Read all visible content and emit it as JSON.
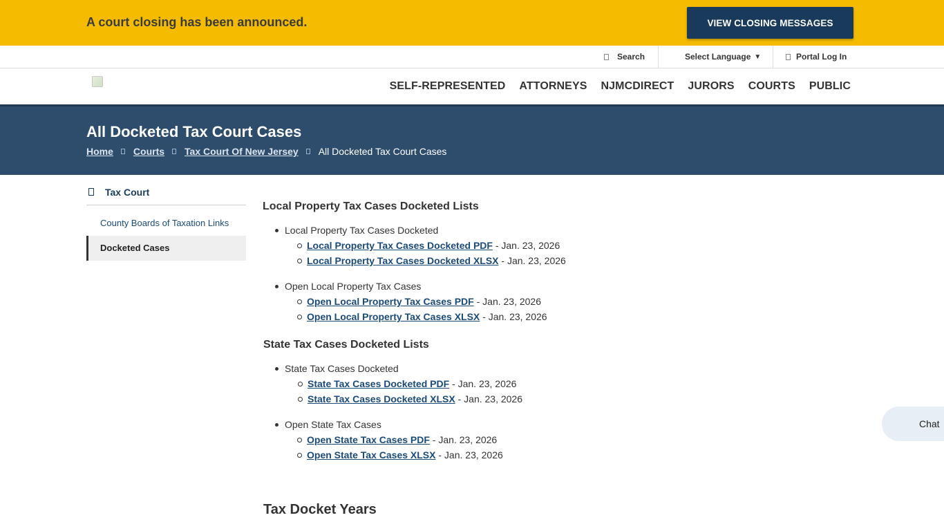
{
  "alert": {
    "message": "A court closing has been announced.",
    "button_label": "VIEW CLOSING MESSAGES"
  },
  "utility": {
    "search_label": "Search",
    "language_label": "Select Language",
    "language_caret": "▼",
    "portal_label": "Portal Log In"
  },
  "nav": {
    "items": [
      "SELF-REPRESENTED",
      "ATTORNEYS",
      "NJMCDIRECT",
      "JURORS",
      "COURTS",
      "PUBLIC"
    ]
  },
  "page": {
    "title": "All Docketed Tax Court Cases",
    "breadcrumbs": [
      "Home",
      "Courts",
      "Tax Court Of New Jersey"
    ],
    "current": "All Docketed Tax Court Cases"
  },
  "sidebar": {
    "heading": "Tax Court",
    "items": [
      "County Boards of Taxation Links",
      "Docketed Cases"
    ]
  },
  "content": {
    "section1_title": "Local Property Tax Cases Docketed Lists",
    "group1": {
      "label": "Local Property Tax Cases Docketed",
      "links": [
        {
          "text": "Local Property Tax Cases Docketed PDF",
          "date": " - Jan. 23, 2026"
        },
        {
          "text": "Local Property Tax Cases Docketed XLSX",
          "date": " - Jan. 23, 2026"
        }
      ]
    },
    "group2": {
      "label": "Open Local Property Tax Cases",
      "links": [
        {
          "text": "Open Local Property Tax Cases PDF",
          "date": " - Jan. 23, 2026"
        },
        {
          "text": "Open Local Property Tax Cases XLSX",
          "date": " - Jan. 23, 2026"
        }
      ]
    },
    "section2_title": "State Tax Cases Docketed Lists",
    "group3": {
      "label": "State Tax Cases Docketed",
      "links": [
        {
          "text": "State Tax Cases Docketed PDF",
          "date": " - Jan. 23, 2026"
        },
        {
          "text": "State Tax Cases Docketed XLSX",
          "date": " - Jan. 23, 2026"
        }
      ]
    },
    "group4": {
      "label": "Open State Tax Cases",
      "links": [
        {
          "text": "Open State Tax Cases PDF",
          "date": " - Jan. 23, 2026"
        },
        {
          "text": "Open State Tax Cases XLSX",
          "date": " - Jan. 23, 2026"
        }
      ]
    },
    "section3_title": "Tax Docket Years"
  },
  "chat": {
    "label": "Chat"
  },
  "colors": {
    "alert_bg": "#f4bb00",
    "primary_navy": "#1a3a5c",
    "band_bg": "#2e4d6d"
  }
}
